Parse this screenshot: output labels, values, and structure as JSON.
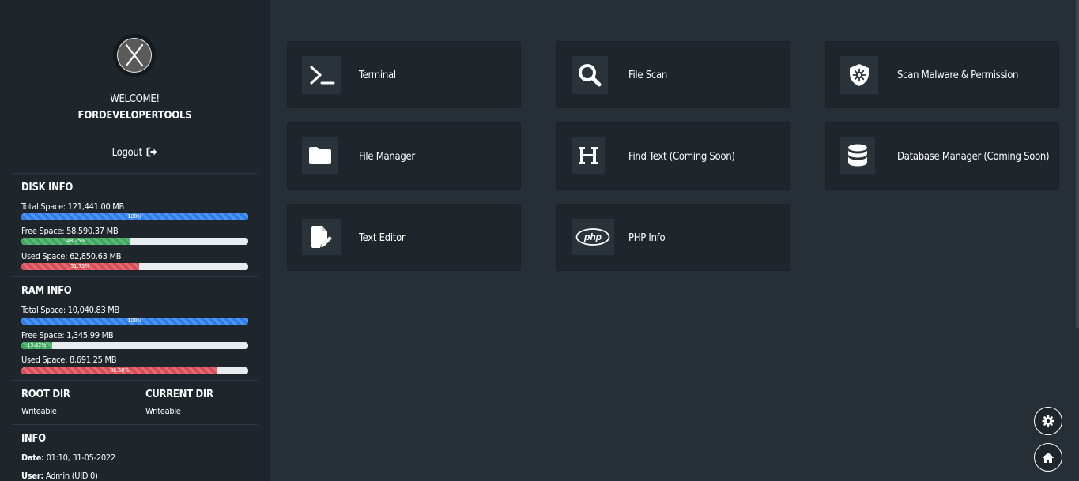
{
  "sidebar": {
    "welcome": "WELCOME!",
    "username": "FORDEVELOPERTOOLS",
    "logout": "Logout",
    "disk": {
      "title": "DISK INFO",
      "total_label": "Total Space: 121,441.00 MB",
      "total_pct": "100%",
      "total_value": 1.0,
      "free_label": "Free Space: 58,590.37 MB",
      "free_pct": "48.25%",
      "free_value": 0.4825,
      "used_label": "Used Space: 62,850.63 MB",
      "used_pct": "51.75%",
      "used_value": 0.5175
    },
    "ram": {
      "title": "RAM INFO",
      "total_label": "Total Space: 10,040.83 MB",
      "total_pct": "100%",
      "total_value": 1.0,
      "free_label": "Free Space: 1,345.99 MB",
      "free_pct": "13.42%",
      "free_value": 0.1342,
      "used_label": "Used Space: 8,691.25 MB",
      "used_pct": "86.58%",
      "used_value": 0.8658
    },
    "root_dir": {
      "title": "ROOT DIR",
      "value": "Writeable"
    },
    "current_dir": {
      "title": "CURRENT DIR",
      "value": "Writeable"
    },
    "info": {
      "title": "INFO",
      "date_key": "Date:",
      "date_value": "01:10, 31-05-2022",
      "user_key": "User:",
      "user_value": "Admin (UID 0)"
    }
  },
  "cards": {
    "terminal": "Terminal",
    "file_scan": "File Scan",
    "scan_malware": "Scan Malware & Permission",
    "file_manager": "File Manager",
    "find_text": "Find Text (Coming Soon)",
    "database_manager": "Database Manager (Coming Soon)",
    "text_editor": "Text Editor",
    "php_info": "PHP Info"
  },
  "icons": {
    "terminal": "terminal-icon",
    "file_scan": "search-icon",
    "scan_malware": "shield-virus-icon",
    "file_manager": "folder-icon",
    "find_text": "heading-icon",
    "database_manager": "database-icon",
    "text_editor": "file-pen-icon",
    "php_info": "php-icon",
    "settings": "gear-icon",
    "home": "home-icon",
    "logout": "sign-out-icon"
  },
  "colors": {
    "bar_total": "#2b7de9",
    "bar_free": "#3aa65a",
    "bar_used": "#d94a55",
    "sidebar_bg": "#1e252b",
    "main_bg": "#262f35"
  }
}
